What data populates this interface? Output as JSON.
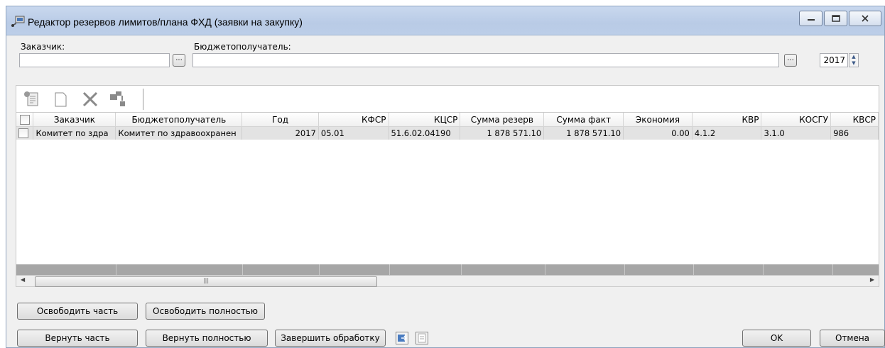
{
  "window": {
    "title": "Редактор резервов лимитов/плана ФХД (заявки на закупку)"
  },
  "filters": {
    "customer_label": "Заказчик:",
    "customer_value": "",
    "recipient_label": "Бюджетополучатель:",
    "recipient_value": "",
    "ellipsis": "...",
    "year": "2017"
  },
  "grid": {
    "columns": [
      "Заказчик",
      "Бюджетополучатель",
      "Год",
      "КФСР",
      "КЦСР",
      "Сумма резерв",
      "Сумма факт",
      "Экономия",
      "КВР",
      "КОСГУ",
      "КВСР"
    ],
    "rows": [
      [
        "Комитет по здра",
        "Комитет по здравоохранен",
        "2017",
        "05.01",
        "51.6.02.04190",
        "1 878 571.10",
        "1 878 571.10",
        "0.00",
        "4.1.2",
        "3.1.0",
        "986"
      ]
    ],
    "scroll_grip": "|||"
  },
  "buttons": {
    "release_part": "Освободить часть",
    "release_full": "Освободить полностью",
    "return_part": "Вернуть часть",
    "return_full": "Вернуть полностью",
    "finish": "Завершить обработку",
    "ok": "OK",
    "cancel": "Отмена"
  },
  "colors": {
    "row_bg": "#e3e3e3",
    "footer_bg": "#a6a6a6",
    "titlebar": "#c9d8ee"
  }
}
